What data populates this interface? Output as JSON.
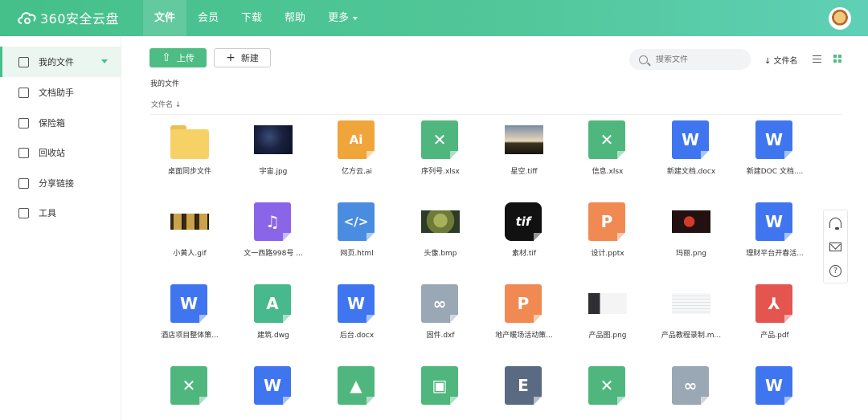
{
  "app": {
    "logo_text": "360安全云盘"
  },
  "nav": {
    "items": [
      {
        "label": "文件",
        "active": true
      },
      {
        "label": "会员"
      },
      {
        "label": "下载"
      },
      {
        "label": "帮助"
      },
      {
        "label": "更多"
      }
    ]
  },
  "sidebar": {
    "items": [
      {
        "label": "我的文件",
        "icon": "file-icon",
        "active": true
      },
      {
        "label": "文档助手",
        "icon": "doc-assistant-icon"
      },
      {
        "label": "保险箱",
        "icon": "safe-icon"
      },
      {
        "label": "回收站",
        "icon": "trash-icon"
      },
      {
        "label": "分享链接",
        "icon": "share-link-icon"
      },
      {
        "label": "工具",
        "icon": "tools-icon"
      }
    ]
  },
  "toolbar": {
    "upload_label": "上传",
    "new_label": "新建",
    "search_placeholder": "搜索文件",
    "sort_label": "↓ 文件名"
  },
  "breadcrumb": "我的文件",
  "column_header": "文件名  ↓",
  "colors": {
    "accent": "#4ebd83",
    "excel": "#4fb77e",
    "word": "#3f76f0",
    "ai": "#f0a53a",
    "ppt": "#f08a52",
    "pdf": "#e5554f",
    "music": "#8b65e8",
    "html": "#4a8de0",
    "dxf": "#9aa7b5",
    "dwg": "#47b98c"
  },
  "files": [
    {
      "name": "桌面同步文件",
      "kind": "folder"
    },
    {
      "name": "宇宙.jpg",
      "kind": "photo",
      "tone": "space"
    },
    {
      "name": "亿方云.ai",
      "kind": "doc",
      "type": "ai",
      "glyph": "Ai"
    },
    {
      "name": "序列号.xlsx",
      "kind": "doc",
      "type": "excel",
      "glyph": "✕"
    },
    {
      "name": "星空.tiff",
      "kind": "photo",
      "tone": "tree"
    },
    {
      "name": "信息.xlsx",
      "kind": "doc",
      "type": "excel",
      "glyph": "✕"
    },
    {
      "name": "新建文档.docx",
      "kind": "doc",
      "type": "word",
      "glyph": "W"
    },
    {
      "name": "新建DOC 文档....",
      "kind": "doc",
      "type": "word",
      "glyph": "W"
    },
    {
      "name": "小黄人.gif",
      "kind": "photo",
      "tone": "minions"
    },
    {
      "name": "文一西路998号 ...",
      "kind": "doc",
      "type": "music",
      "glyph": "♫"
    },
    {
      "name": "网页.html",
      "kind": "doc",
      "type": "html",
      "glyph": "</>"
    },
    {
      "name": "头像.bmp",
      "kind": "photo",
      "tone": "shrek"
    },
    {
      "name": "素材.tif",
      "kind": "doc",
      "type": "tif",
      "glyph": "tif"
    },
    {
      "name": "设计.pptx",
      "kind": "doc",
      "type": "ppt",
      "glyph": "P"
    },
    {
      "name": "玛丽.png",
      "kind": "photo",
      "tone": "mario"
    },
    {
      "name": "理财平台开春活...",
      "kind": "doc",
      "type": "word",
      "glyph": "W"
    },
    {
      "name": "酒店项目整体策...",
      "kind": "doc",
      "type": "word",
      "glyph": "W"
    },
    {
      "name": "建筑.dwg",
      "kind": "doc",
      "type": "dwg",
      "glyph": "A"
    },
    {
      "name": "后台.docx",
      "kind": "doc",
      "type": "word",
      "glyph": "W"
    },
    {
      "name": "固件.dxf",
      "kind": "doc",
      "type": "dxf",
      "glyph": "∞"
    },
    {
      "name": "地产暖场活动策...",
      "kind": "doc",
      "type": "ppt",
      "glyph": "P"
    },
    {
      "name": "产品图.png",
      "kind": "photo",
      "tone": "devices"
    },
    {
      "name": "产品教程录制.m...",
      "kind": "photo",
      "tone": "sheet"
    },
    {
      "name": "产品.pdf",
      "kind": "doc",
      "type": "pdf",
      "glyph": "⅄"
    },
    {
      "name": "",
      "kind": "doc",
      "type": "excel",
      "glyph": "✕"
    },
    {
      "name": "",
      "kind": "doc",
      "type": "word",
      "glyph": "W"
    },
    {
      "name": "",
      "kind": "doc",
      "type": "image",
      "glyph": "▲"
    },
    {
      "name": "",
      "kind": "doc",
      "type": "android",
      "glyph": "▣"
    },
    {
      "name": "",
      "kind": "doc",
      "type": "e",
      "glyph": "E"
    },
    {
      "name": "",
      "kind": "doc",
      "type": "excel",
      "glyph": "✕"
    },
    {
      "name": "",
      "kind": "doc",
      "type": "dxf",
      "glyph": "∞"
    },
    {
      "name": "",
      "kind": "doc",
      "type": "word",
      "glyph": "W"
    }
  ],
  "float_panel": [
    {
      "icon": "customer-service-icon"
    },
    {
      "icon": "mail-icon"
    },
    {
      "icon": "help-icon",
      "glyph": "?"
    }
  ]
}
